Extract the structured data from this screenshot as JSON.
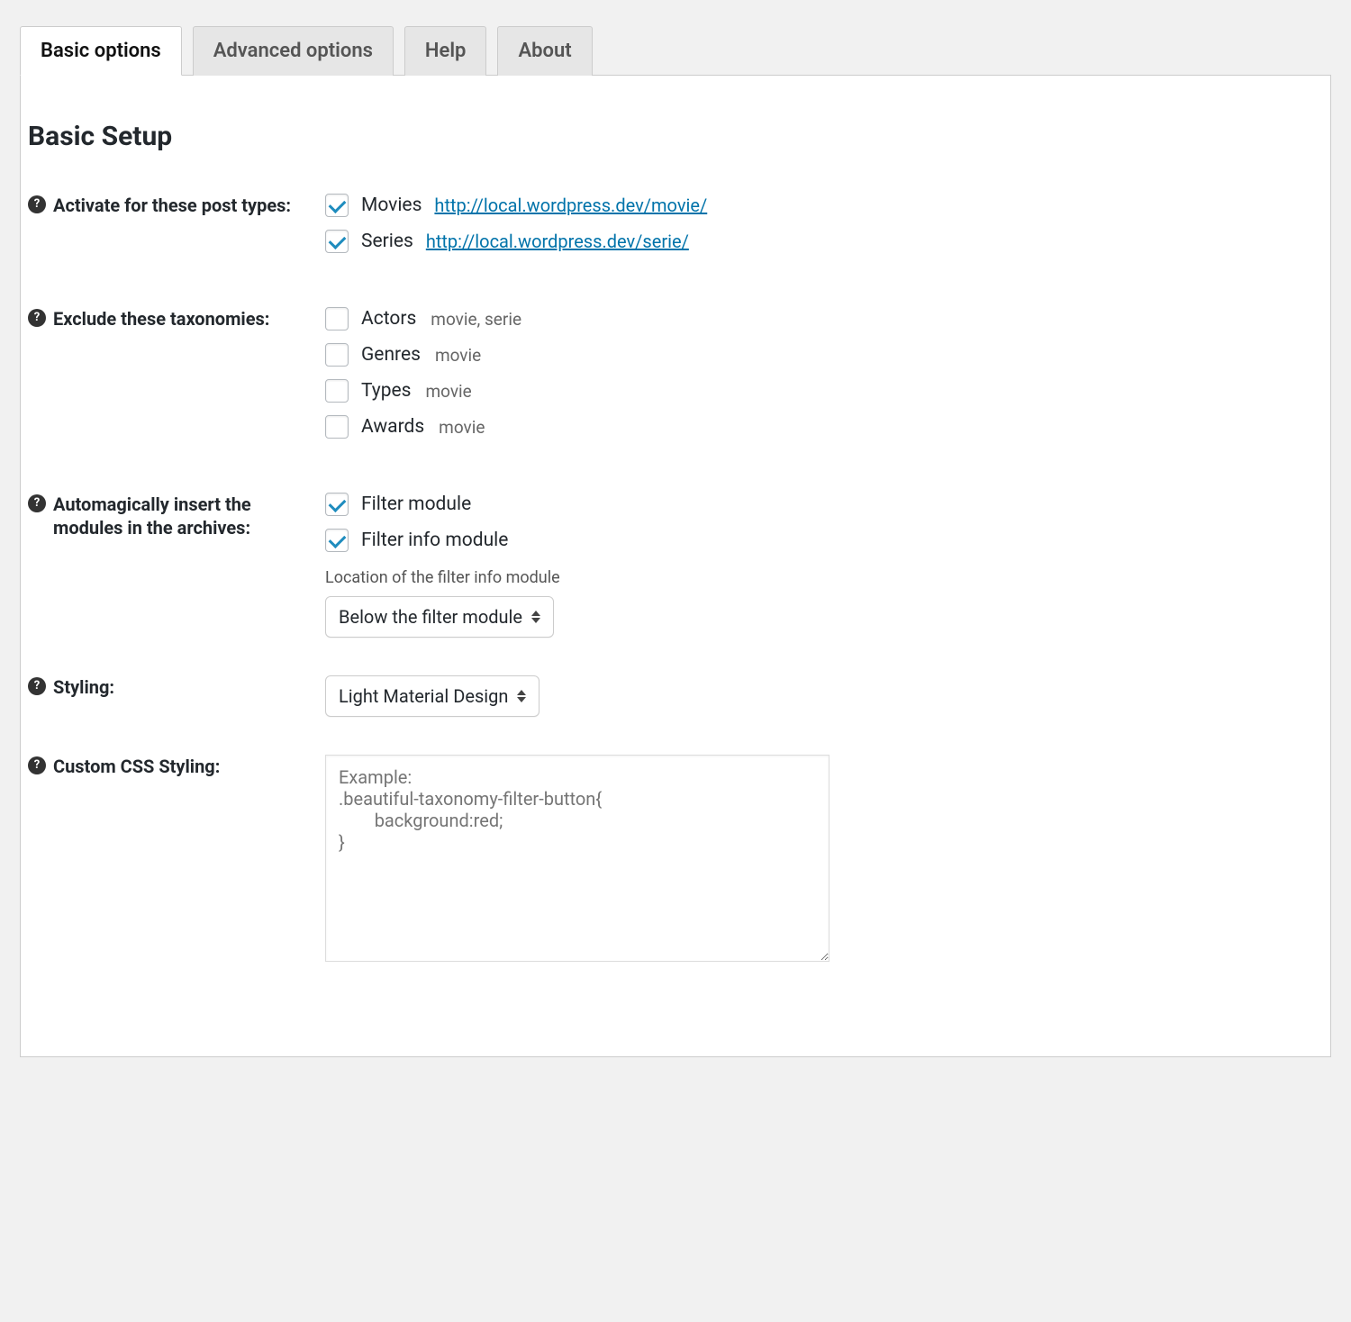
{
  "tabs": [
    {
      "label": "Basic options",
      "active": true
    },
    {
      "label": "Advanced options",
      "active": false
    },
    {
      "label": "Help",
      "active": false
    },
    {
      "label": "About",
      "active": false
    }
  ],
  "section_title": "Basic Setup",
  "rows": {
    "post_types": {
      "label": "Activate for these post types:",
      "items": [
        {
          "checked": true,
          "label": "Movies",
          "url": "http://local.wordpress.dev/movie/"
        },
        {
          "checked": true,
          "label": "Series",
          "url": "http://local.wordpress.dev/serie/"
        }
      ]
    },
    "excl_tax": {
      "label": "Exclude these taxonomies:",
      "items": [
        {
          "checked": false,
          "label": "Actors",
          "meta": "movie, serie"
        },
        {
          "checked": false,
          "label": "Genres",
          "meta": "movie"
        },
        {
          "checked": false,
          "label": "Types",
          "meta": "movie"
        },
        {
          "checked": false,
          "label": "Awards",
          "meta": "movie"
        }
      ]
    },
    "auto_insert": {
      "label": "Automagically insert the modules in the archives:",
      "items": [
        {
          "checked": true,
          "label": "Filter module"
        },
        {
          "checked": true,
          "label": "Filter info module"
        }
      ],
      "location_label": "Location of the filter info module",
      "location_value": "Below the filter module"
    },
    "styling": {
      "label": "Styling:",
      "value": "Light Material Design"
    },
    "custom_css": {
      "label": "Custom CSS Styling:",
      "placeholder": "Example:\n.beautiful-taxonomy-filter-button{\n        background:red;\n}"
    }
  }
}
